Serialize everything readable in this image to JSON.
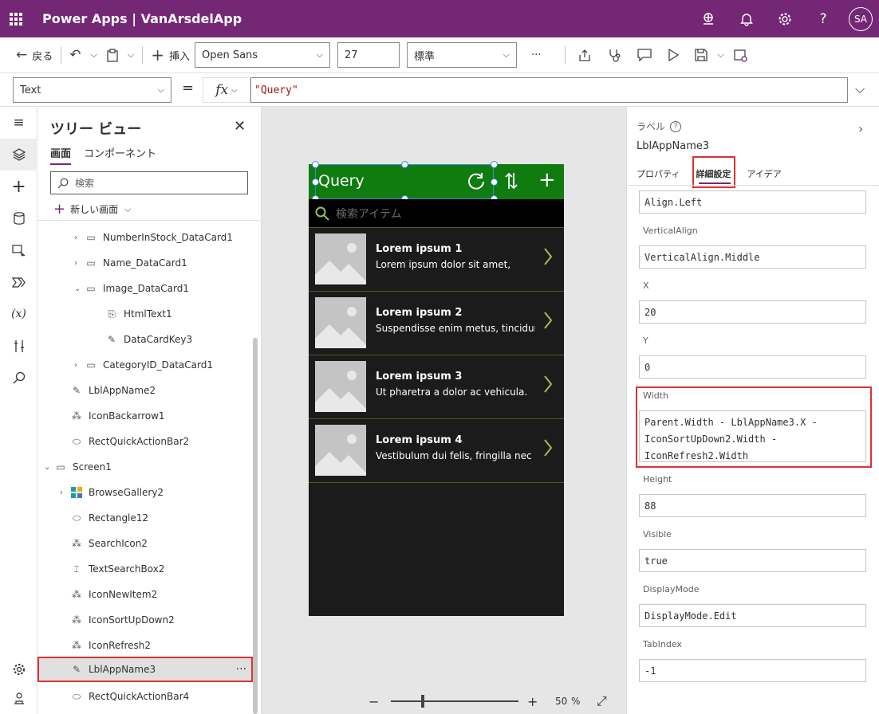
{
  "header": {
    "title": "Power Apps  |  VanArsdelApp",
    "avatar": "SA"
  },
  "toolbar": {
    "back": "戻る",
    "insert": "挿入",
    "font": "Open Sans",
    "font_size": "27",
    "weight": "標準",
    "more": "···"
  },
  "formula": {
    "property": "Text",
    "equals": "=",
    "fx": "fx",
    "value": "\"Query\""
  },
  "tree": {
    "title": "ツリー ビュー",
    "tabs": [
      "画面",
      "コンポーネント"
    ],
    "search_placeholder": "検索",
    "new_screen": "新しい画面",
    "items": [
      {
        "label": "NumberInStock_DataCard1"
      },
      {
        "label": "Name_DataCard1"
      },
      {
        "label": "Image_DataCard1"
      },
      {
        "label": "HtmlText1"
      },
      {
        "label": "DataCardKey3"
      },
      {
        "label": "CategoryID_DataCard1"
      },
      {
        "label": "LblAppName2"
      },
      {
        "label": "IconBackarrow1"
      },
      {
        "label": "RectQuickActionBar2"
      },
      {
        "label": "Screen1"
      },
      {
        "label": "BrowseGallery2"
      },
      {
        "label": "Rectangle12"
      },
      {
        "label": "SearchIcon2"
      },
      {
        "label": "TextSearchBox2"
      },
      {
        "label": "IconNewItem2"
      },
      {
        "label": "IconSortUpDown2"
      },
      {
        "label": "IconRefresh2"
      },
      {
        "label": "LblAppName3"
      },
      {
        "label": "RectQuickActionBar4"
      }
    ],
    "more": "···"
  },
  "phone": {
    "title": "Query",
    "search_placeholder": "検索アイテム",
    "items": [
      {
        "title": "Lorem ipsum 1",
        "sub": "Lorem ipsum dolor sit amet,"
      },
      {
        "title": "Lorem ipsum 2",
        "sub": "Suspendisse enim metus, tincidunt"
      },
      {
        "title": "Lorem ipsum 3",
        "sub": "Ut pharetra a dolor ac vehicula."
      },
      {
        "title": "Lorem ipsum 4",
        "sub": "Vestibulum dui felis, fringilla nec mi"
      }
    ]
  },
  "zoom": {
    "minus": "−",
    "plus": "+",
    "value": "50",
    "unit": "%"
  },
  "right": {
    "label": "ラベル",
    "name": "LblAppName3",
    "tabs": [
      "プロパティ",
      "詳細設定",
      "アイデア"
    ],
    "fields": {
      "align": "Align.Left",
      "valign_label": "VerticalAlign",
      "valign": "VerticalAlign.Middle",
      "x_label": "X",
      "x": "20",
      "y_label": "Y",
      "y": "0",
      "width_label": "Width",
      "width_lines": [
        "Parent.Width - LblAppName3.X -",
        "IconSortUpDown2.Width -",
        "IconRefresh2.Width"
      ],
      "height_label": "Height",
      "height": "88",
      "visible_label": "Visible",
      "visible": "true",
      "display_label": "DisplayMode",
      "display": "DisplayMode.Edit",
      "tab_label": "TabIndex",
      "tab": "-1"
    }
  }
}
